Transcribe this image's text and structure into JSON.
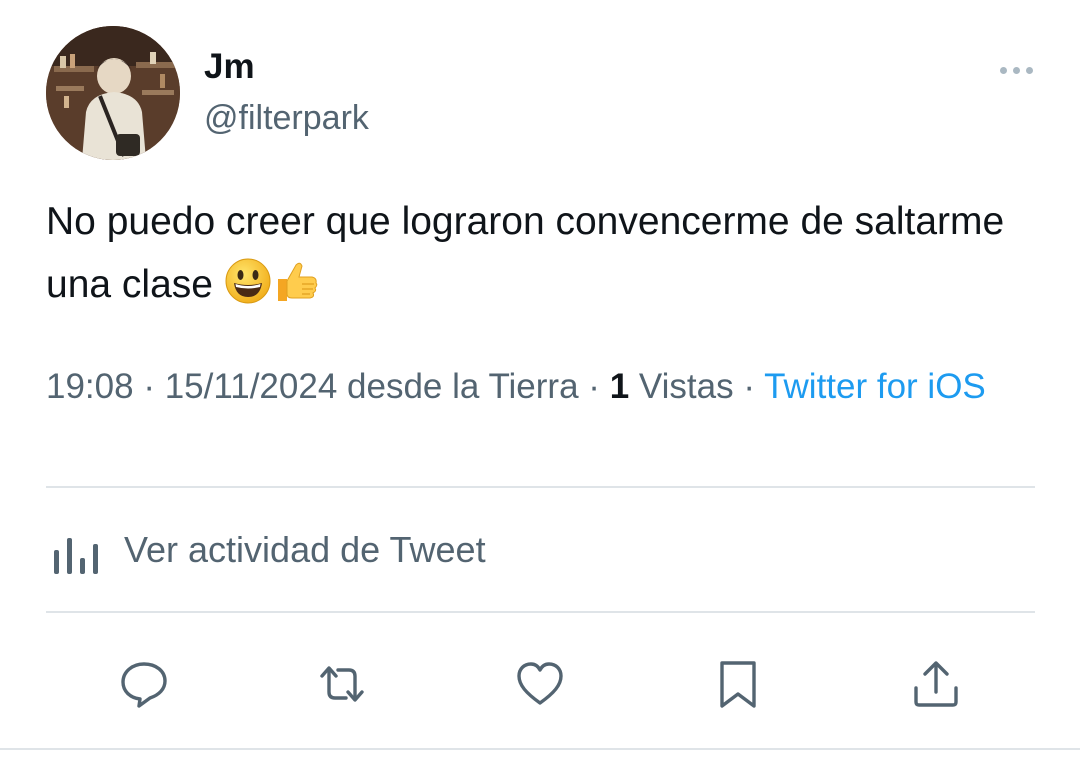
{
  "tweet": {
    "author": {
      "display_name": "Jm",
      "handle": "@filterpark"
    },
    "text": "No puedo creer que lograron convencerme de saltarme una clase",
    "emojis": [
      "smiling-face-emoji",
      "thumbs-up-emoji"
    ],
    "meta": {
      "time": "19:08",
      "separator": "·",
      "date": "15/11/2024",
      "location": "desde la Tierra",
      "views_count": "1",
      "views_label": "Vistas",
      "source": "Twitter for iOS"
    },
    "activity_label": "Ver actividad de Tweet"
  },
  "actions": [
    "reply-icon",
    "retweet-icon",
    "like-icon",
    "bookmark-icon",
    "share-icon"
  ],
  "colors": {
    "text": "#0f1419",
    "secondary": "#536471",
    "link": "#1d9bf0",
    "divider": "#dfe4e8"
  }
}
